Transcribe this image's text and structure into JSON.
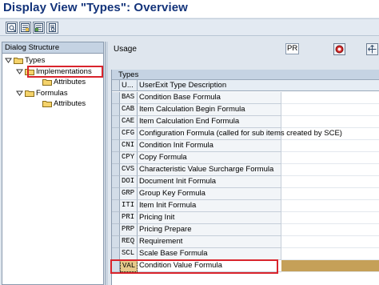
{
  "window": {
    "title": "Display View \"Types\": Overview"
  },
  "toolbar": {
    "buttons": [
      {
        "icon": "table-settings-icon"
      },
      {
        "icon": "select-all-icon"
      },
      {
        "icon": "deselect-all-icon"
      },
      {
        "icon": "print-preview-icon"
      }
    ]
  },
  "dialog_structure": {
    "header": "Dialog Structure",
    "tree": [
      {
        "label": "Types",
        "level": 0,
        "expanded": true
      },
      {
        "label": "Implementations",
        "level": 1,
        "expanded": true,
        "highlighted": true
      },
      {
        "label": "Attributes",
        "level": 2
      },
      {
        "label": "Formulas",
        "level": 1,
        "expanded": true
      },
      {
        "label": "Attributes",
        "level": 2
      }
    ]
  },
  "usage": {
    "label": "Usage",
    "value": "PR"
  },
  "table": {
    "caption": "Types",
    "columns": {
      "code": "U...",
      "description": "UserExit Type Description"
    },
    "rows": [
      {
        "code": "BAS",
        "description": "Condition Base Formula"
      },
      {
        "code": "CAB",
        "description": "Item Calculation Begin Formula"
      },
      {
        "code": "CAE",
        "description": "Item Calculation End Formula"
      },
      {
        "code": "CFG",
        "description": "Configuration Formula (called for sub items created by SCE)"
      },
      {
        "code": "CNI",
        "description": "Condition Init Formula"
      },
      {
        "code": "CPY",
        "description": "Copy Formula"
      },
      {
        "code": "CVS",
        "description": "Characteristic Value Surcharge Formula"
      },
      {
        "code": "DOI",
        "description": "Document Init Formula"
      },
      {
        "code": "GRP",
        "description": "Group Key Formula"
      },
      {
        "code": "ITI",
        "description": "Item Init Formula"
      },
      {
        "code": "PRI",
        "description": "Pricing Init"
      },
      {
        "code": "PRP",
        "description": "Pricing Prepare"
      },
      {
        "code": "REQ",
        "description": "Requirement"
      },
      {
        "code": "SCL",
        "description": "Scale Base Formula"
      },
      {
        "code": "VAL",
        "description": "Condition Value Formula",
        "selected": true
      }
    ]
  },
  "colors": {
    "title": "#13337a",
    "highlight_box": "#d9242c",
    "selected_row": "#c5a058"
  }
}
